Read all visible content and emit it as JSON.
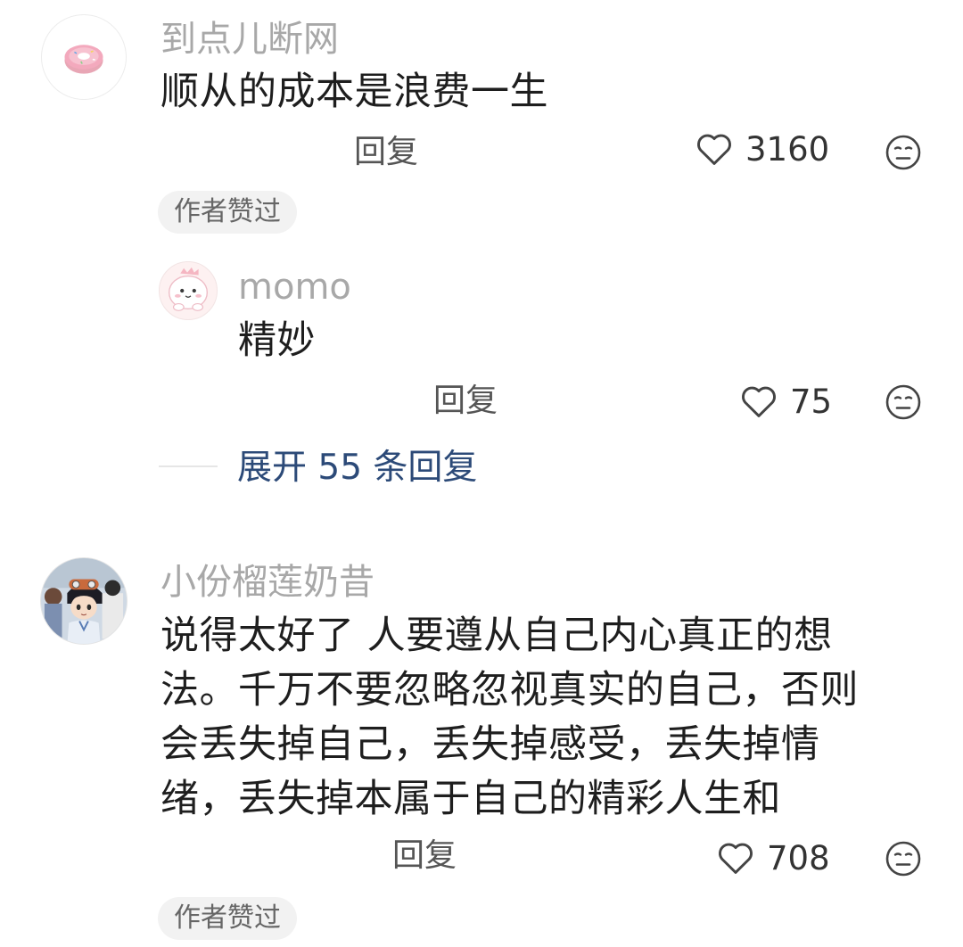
{
  "comments": [
    {
      "username": "到点儿断网",
      "text": "顺从的成本是浪费一生",
      "reply_label": "回复",
      "likes": "3160",
      "badge": "作者赞过",
      "avatar_icon": "donut-icon",
      "replies": [
        {
          "username": "momo",
          "text": "精妙",
          "reply_label": "回复",
          "likes": "75",
          "avatar_icon": "cartoon-dino-icon"
        }
      ],
      "expand_label": "展开 55 条回复"
    },
    {
      "username": "小份榴莲奶昔",
      "text_lines": [
        "说得太好了 人要遵从自己内心真正的想",
        "法。千万不要忽略忽视真实的自己，否则",
        "会丢失掉自己，丢失掉感受，丢失掉情",
        "绪，丢失掉本属于自己的精彩人生和"
      ],
      "reply_label": "回复",
      "likes": "708",
      "badge": "作者赞过",
      "avatar_icon": "anime-character-icon"
    }
  ],
  "icons": {
    "like": "heart-outline-icon",
    "dislike": "meh-face-icon"
  },
  "colors": {
    "username": "#a8a8a8",
    "text": "#1e1e1e",
    "expand_link": "#2c4a78",
    "badge_bg": "#f2f2f2"
  }
}
